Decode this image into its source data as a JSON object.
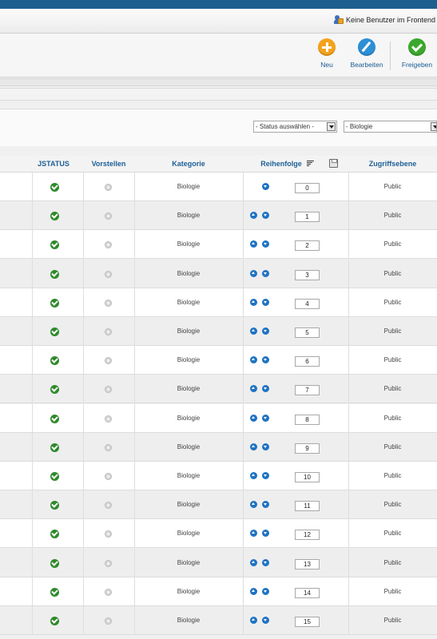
{
  "status": {
    "users_text": "Keine Benutzer im Frontend"
  },
  "toolbar": {
    "new_label": "Neu",
    "edit_label": "Bearbeiten",
    "publish_label": "Freigeben"
  },
  "filters": {
    "status_placeholder": "- Status auswählen -",
    "category_selected": "- Biologie"
  },
  "table": {
    "headers": {
      "jstatus": "JSTATUS",
      "vorstellen": "Vorstellen",
      "kategorie": "Kategorie",
      "reihenfolge": "Reihenfolge",
      "zugriffsebene": "Zugriffsebene"
    },
    "rows": [
      {
        "kategorie": "Biologie",
        "order": "0",
        "access": "Public",
        "status": "published",
        "featured": false,
        "can_move_up": false,
        "can_move_down": true
      },
      {
        "kategorie": "Biologie",
        "order": "1",
        "access": "Public",
        "status": "published",
        "featured": false,
        "can_move_up": true,
        "can_move_down": true
      },
      {
        "kategorie": "Biologie",
        "order": "2",
        "access": "Public",
        "status": "published",
        "featured": false,
        "can_move_up": true,
        "can_move_down": true
      },
      {
        "kategorie": "Biologie",
        "order": "3",
        "access": "Public",
        "status": "published",
        "featured": false,
        "can_move_up": true,
        "can_move_down": true
      },
      {
        "kategorie": "Biologie",
        "order": "4",
        "access": "Public",
        "status": "published",
        "featured": false,
        "can_move_up": true,
        "can_move_down": true
      },
      {
        "kategorie": "Biologie",
        "order": "5",
        "access": "Public",
        "status": "published",
        "featured": false,
        "can_move_up": true,
        "can_move_down": true
      },
      {
        "kategorie": "Biologie",
        "order": "6",
        "access": "Public",
        "status": "published",
        "featured": false,
        "can_move_up": true,
        "can_move_down": true
      },
      {
        "kategorie": "Biologie",
        "order": "7",
        "access": "Public",
        "status": "published",
        "featured": false,
        "can_move_up": true,
        "can_move_down": true
      },
      {
        "kategorie": "Biologie",
        "order": "8",
        "access": "Public",
        "status": "published",
        "featured": false,
        "can_move_up": true,
        "can_move_down": true
      },
      {
        "kategorie": "Biologie",
        "order": "9",
        "access": "Public",
        "status": "published",
        "featured": false,
        "can_move_up": true,
        "can_move_down": true
      },
      {
        "kategorie": "Biologie",
        "order": "10",
        "access": "Public",
        "status": "published",
        "featured": false,
        "can_move_up": true,
        "can_move_down": true
      },
      {
        "kategorie": "Biologie",
        "order": "11",
        "access": "Public",
        "status": "published",
        "featured": false,
        "can_move_up": true,
        "can_move_down": true
      },
      {
        "kategorie": "Biologie",
        "order": "12",
        "access": "Public",
        "status": "published",
        "featured": false,
        "can_move_up": true,
        "can_move_down": true
      },
      {
        "kategorie": "Biologie",
        "order": "13",
        "access": "Public",
        "status": "published",
        "featured": false,
        "can_move_up": true,
        "can_move_down": true
      },
      {
        "kategorie": "Biologie",
        "order": "14",
        "access": "Public",
        "status": "published",
        "featured": false,
        "can_move_up": true,
        "can_move_down": true
      },
      {
        "kategorie": "Biologie",
        "order": "15",
        "access": "Public",
        "status": "published",
        "featured": false,
        "can_move_up": true,
        "can_move_down": true
      }
    ]
  },
  "colors": {
    "brand_bar": "#1d5f8f",
    "link": "#1d5f97",
    "published": "#2f8a2c",
    "order_arrow": "#1f73c2"
  }
}
